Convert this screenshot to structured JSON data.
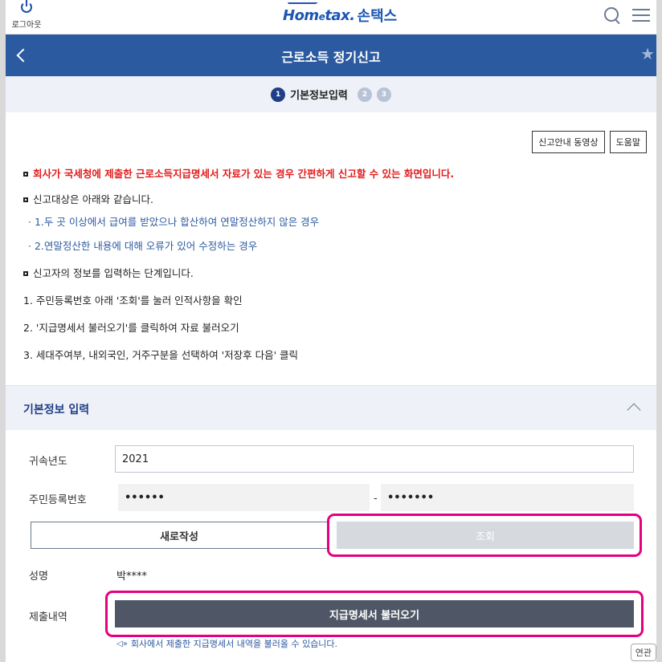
{
  "header": {
    "logout_label": "로그아웃",
    "logo_prefix": "Hom",
    "logo_mid": "e",
    "logo_suffix": "tax.",
    "logo_korean": "손택스",
    "icons": [
      "power-icon",
      "search-icon",
      "menu-icon"
    ]
  },
  "titlebar": {
    "title": "근로소득 정기신고",
    "icons": [
      "back-icon",
      "star-icon"
    ]
  },
  "steps": {
    "items": [
      {
        "num": "1",
        "label": "기본정보입력",
        "active": true
      },
      {
        "num": "2",
        "label": "",
        "active": false
      },
      {
        "num": "3",
        "label": "",
        "active": false
      }
    ]
  },
  "guide": {
    "buttons": [
      "신고안내 동영상",
      "도움말"
    ],
    "lines": [
      "회사가 국세청에 제출한 근로소득지급명세서 자료가 있는 경우 간편하게 신고할 수 있는 화면입니다.",
      "신고대상은 아래와 같습니다.",
      "· 1.두 곳 이상에서 급여를 받았으나 합산하여 연말정산하지 않은 경우",
      "· 2.연말정산한 내용에 대해 오류가 있어 수정하는 경우",
      "신고자의 정보를 입력하는 단계입니다.",
      "1. 주민등록번호 아래 '조회'를 눌러 인적사항을 확인",
      "2. '지급명세서 불러오기'를 클릭하여 자료 불러오기",
      "3. 세대주여부, 내외국인, 거주구분을 선택하여 '저장후 다음' 클릭"
    ]
  },
  "section": {
    "title": "기본정보 입력"
  },
  "form": {
    "year_label": "귀속년도",
    "year_value": "2021",
    "rrn_label": "주민등록번호",
    "rrn_front": "••••••",
    "rrn_dash": "-",
    "rrn_back": "•••••••",
    "new_button": "새로작성",
    "search_button": "조회",
    "name_label": "성명",
    "name_value": "박****",
    "submit_label": "제출내역",
    "load_button": "지급명세서 불러오기",
    "note": "회사에서 제출한 지급명세서 내역을 불러올 수 있습니다.",
    "related": "연관"
  },
  "colors": {
    "brand": "#2c5aa0",
    "alert": "#e21b1b",
    "highlight": "#e4007f",
    "dark_button": "#4f5766"
  }
}
